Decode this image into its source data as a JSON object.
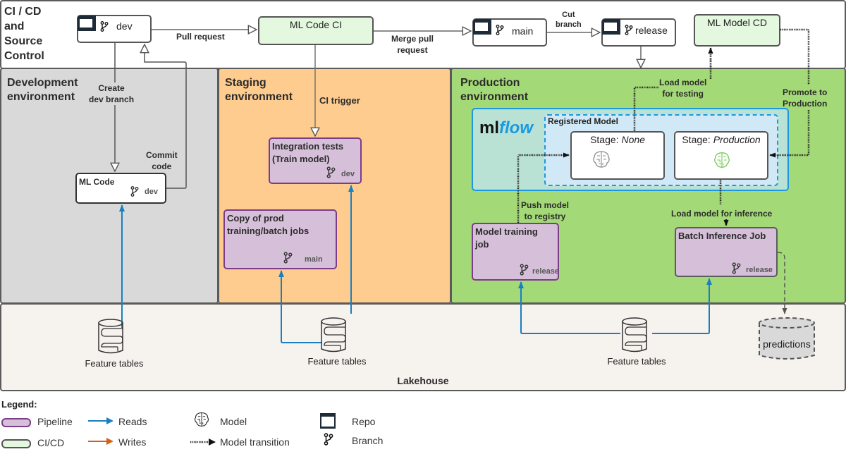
{
  "zones": {
    "cicd": "CI / CD\nand\nSource\nControl",
    "development": "Development\nenvironment",
    "staging": "Staging\nenvironment",
    "production": "Production\nenvironment",
    "lakehouse": "Lakehouse"
  },
  "repos": {
    "dev": "dev",
    "main": "main",
    "release": "release"
  },
  "ci_boxes": {
    "ml_code_ci": "ML Code CI",
    "ml_model_cd": "ML Model CD"
  },
  "edges": {
    "pull_request": "Pull request",
    "merge_pull_request": "Merge pull\nrequest",
    "cut_branch": "Cut\nbranch",
    "create_dev_branch": "Create\ndev branch",
    "commit_code": "Commit\ncode",
    "ci_trigger": "CI trigger",
    "load_model_for_testing": "Load model\nfor testing",
    "promote_to_production": "Promote to\nProduction",
    "push_model_to_registry": "Push model\nto registry",
    "load_model_for_inference": "Load model for inference"
  },
  "pipelines": {
    "ml_code": {
      "title": "ML Code",
      "branch": "dev"
    },
    "integration_tests": {
      "title": "Integration tests\n(Train model)",
      "branch": "dev"
    },
    "copy_prod_jobs": {
      "title": "Copy of prod\ntraining/batch jobs",
      "branch": "main"
    },
    "model_training_job": {
      "title": "Model training\njob",
      "branch": "release"
    },
    "batch_inference_job": {
      "title": "Batch Inference Job",
      "branch": "release"
    }
  },
  "mlflow": {
    "logo_ml": "ml",
    "logo_flow": "flow",
    "registered_model": "Registered Model",
    "stage_none_prefix": "Stage: ",
    "stage_none_value": "None",
    "stage_prod_prefix": "Stage: ",
    "stage_prod_value": "Production"
  },
  "lakehouse": {
    "feature_tables_dev": "Feature tables",
    "feature_tables_staging": "Feature tables",
    "feature_tables_prod": "Feature tables",
    "predictions": "predictions"
  },
  "legend": {
    "title": "Legend:",
    "pipeline": "Pipeline",
    "cicd": "CI/CD",
    "reads": "Reads",
    "writes": "Writes",
    "model": "Model",
    "model_transition": "Model transition",
    "repo": "Repo",
    "branch": "Branch"
  },
  "colors": {
    "dev_zone": "#d9d9d9",
    "staging_zone": "#ffcc8f",
    "production_zone": "#a4d977",
    "lakehouse_zone": "#f6f2ee",
    "pipeline_fill": "#d6bfd9",
    "pipeline_border": "#7b3c8a",
    "cicd_fill": "#e3f8df",
    "reads_arrow": "#1a7fc1",
    "writes_arrow": "#d4601b",
    "mlflow_blue": "#1b98e0"
  }
}
